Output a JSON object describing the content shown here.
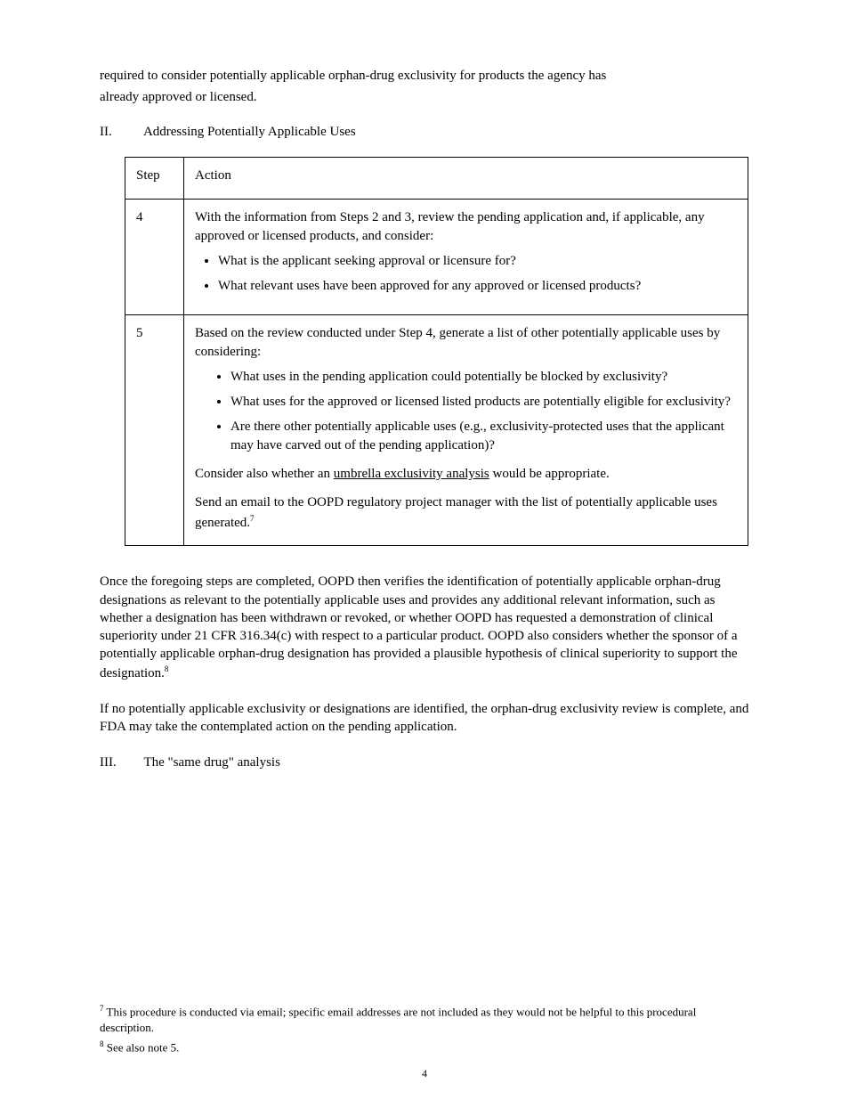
{
  "pre": {
    "line1": "required to consider potentially applicable orphan-drug exclusivity for products the agency has",
    "line2": "already approved or licensed.",
    "line3_a": "II.",
    "line3_b": "Addressing Potentially Applicable Uses"
  },
  "table": {
    "headers": {
      "step": "Step",
      "action": "Action"
    },
    "rows": [
      {
        "step": "4",
        "intro": "With the information from Steps 2 and 3, review the pending application and, if applicable, any approved or licensed products, and consider:",
        "bullets": [
          "What is the applicant seeking approval or licensure for?",
          "What relevant uses have been approved for any approved or licensed products?"
        ],
        "note": ""
      },
      {
        "step": "5",
        "intro": "Based on the review conducted under Step 4, generate a list of other potentially applicable uses by considering:",
        "bullets": [
          "What uses in the pending application could potentially be blocked by exclusivity?",
          "What uses for the approved or licensed listed products are potentially eligible for exclusivity?",
          "Are there other potentially applicable uses (e.g., exclusivity-protected uses that the applicant may have carved out of the pending application)?"
        ],
        "note_a": "Consider also whether an ",
        "note_link": "umbrella exclusivity analysis",
        "note_b": " would be appropriate.",
        "note2": "Send an email to the OOPD regulatory project manager with the list of potentially applicable uses generated.",
        "footnote_mark": "7"
      }
    ]
  },
  "post": {
    "p1": "Once the foregoing steps are completed, OOPD then verifies the identification of potentially applicable orphan-drug designations as relevant to the potentially applicable uses and provides any additional relevant information, such as whether a designation has been withdrawn or revoked, or whether OOPD has requested a demonstration of clinical superiority under 21 CFR 316.34(c) with respect to a particular product. OOPD also considers whether the sponsor of a potentially applicable orphan-drug designation has provided a plausible hypothesis of clinical superiority to support the designation.",
    "p2": "If no potentially applicable exclusivity or designations are identified, the orphan-drug exclusivity review is complete, and FDA may take the contemplated action on the pending application.",
    "p3_a": "III.",
    "p3_b": "The \"same drug\" analysis"
  },
  "footer": {
    "fn7_mark": "7",
    "fn7": "This procedure is conducted via email; specific email addresses are not included as they would not be helpful to this procedural description.",
    "fn8_mark": "8",
    "fn8": "See also note 5.",
    "page_num": "4"
  }
}
